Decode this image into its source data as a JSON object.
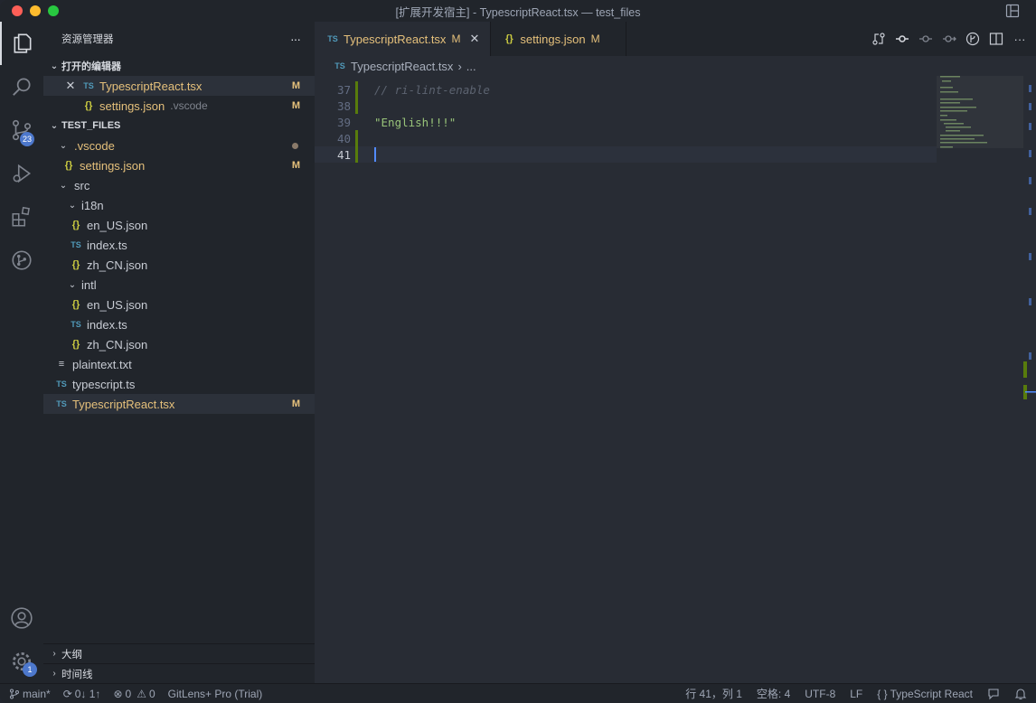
{
  "window": {
    "title": "[扩展开发宿主] - TypescriptReact.tsx — test_files"
  },
  "activity": {
    "items": [
      {
        "icon": "files-icon",
        "active": true
      },
      {
        "icon": "search-icon"
      },
      {
        "icon": "source-control-icon",
        "badge": "23"
      },
      {
        "icon": "run-debug-icon"
      },
      {
        "icon": "extensions-icon"
      },
      {
        "icon": "gitlens-icon"
      }
    ],
    "bottom": [
      {
        "icon": "account-icon"
      },
      {
        "icon": "gear-icon",
        "badge": "1"
      }
    ]
  },
  "sidebar": {
    "title": "资源管理器",
    "more": "···",
    "open_editors": {
      "label": "打开的编辑器",
      "items": [
        {
          "name": "TypescriptReact.tsx",
          "type": "ts",
          "flag": "M",
          "active": true
        },
        {
          "name": "settings.json",
          "desc": ".vscode",
          "type": "json",
          "flag": "M"
        }
      ]
    },
    "workspace": {
      "label": "TEST_FILES",
      "tree": [
        {
          "name": ".vscode",
          "kind": "folder",
          "depth": 1,
          "dot": true
        },
        {
          "name": "settings.json",
          "kind": "json",
          "depth": 2,
          "flag": "M"
        },
        {
          "name": "src",
          "kind": "folder",
          "depth": 1
        },
        {
          "name": "i18n",
          "kind": "folder",
          "depth": 2
        },
        {
          "name": "en_US.json",
          "kind": "json",
          "depth": 3
        },
        {
          "name": "index.ts",
          "kind": "ts",
          "depth": 3
        },
        {
          "name": "zh_CN.json",
          "kind": "json",
          "depth": 3
        },
        {
          "name": "intl",
          "kind": "folder",
          "depth": 2
        },
        {
          "name": "en_US.json",
          "kind": "json",
          "depth": 3
        },
        {
          "name": "index.ts",
          "kind": "ts",
          "depth": 3
        },
        {
          "name": "zh_CN.json",
          "kind": "json",
          "depth": 3
        },
        {
          "name": "plaintext.txt",
          "kind": "txt",
          "depth": 1
        },
        {
          "name": "typescript.ts",
          "kind": "ts",
          "depth": 1
        },
        {
          "name": "TypescriptReact.tsx",
          "kind": "ts",
          "depth": 1,
          "flag": "M",
          "selected": true
        }
      ]
    },
    "outline": "大纲",
    "timeline": "时间线"
  },
  "tabs": [
    {
      "name": "TypescriptReact.tsx",
      "flag": "M",
      "active": true,
      "type": "ts"
    },
    {
      "name": "settings.json",
      "flag": "M",
      "type": "json"
    }
  ],
  "breadcrumb": {
    "file": "TypescriptReact.tsx",
    "sep": "›",
    "rest": "..."
  },
  "code": {
    "lines": [
      {
        "num": "37",
        "text": "// ri-lint-enable",
        "kind": "comment",
        "mark": true
      },
      {
        "num": "38",
        "text": "",
        "mark": true
      },
      {
        "num": "39",
        "text": "\"English!!!\"",
        "kind": "string"
      },
      {
        "num": "40",
        "text": "",
        "mark": true
      },
      {
        "num": "41",
        "text": "",
        "current": true,
        "mark": true
      }
    ]
  },
  "status": {
    "branch": "main*",
    "sync": "0↓ 1↑",
    "errors": "0",
    "warnings": "0",
    "gitlens": "GitLens+ Pro (Trial)",
    "position": "行 41，列 1",
    "spaces": "空格: 4",
    "encoding": "UTF-8",
    "eol": "LF",
    "language": "TypeScript React"
  },
  "colors": {
    "accent": "#4d78cc",
    "modified": "#e5c07b",
    "added": "#587c0c"
  }
}
